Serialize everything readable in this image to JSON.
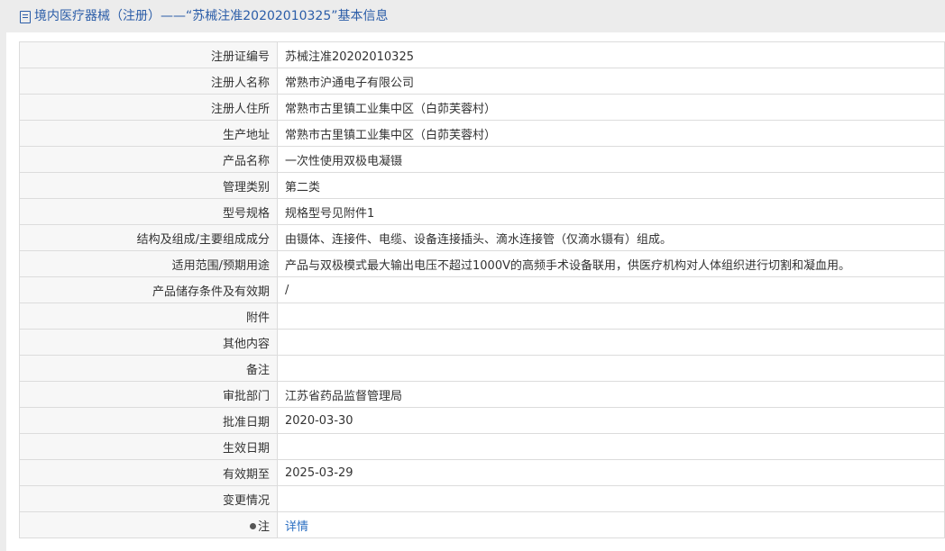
{
  "header": {
    "title": "境内医疗器械（注册）——“苏械注准20202010325”基本信息"
  },
  "rows": [
    {
      "label": "注册证编号",
      "value": "苏械注准20202010325"
    },
    {
      "label": "注册人名称",
      "value": "常熟市沪通电子有限公司"
    },
    {
      "label": "注册人住所",
      "value": "常熟市古里镇工业集中区（白茆芙蓉村）"
    },
    {
      "label": "生产地址",
      "value": "常熟市古里镇工业集中区（白茆芙蓉村）"
    },
    {
      "label": "产品名称",
      "value": "一次性使用双极电凝镊"
    },
    {
      "label": "管理类别",
      "value": "第二类"
    },
    {
      "label": "型号规格",
      "value": "规格型号见附件1"
    },
    {
      "label": "结构及组成/主要组成成分",
      "value": "由镊体、连接件、电缆、设备连接插头、滴水连接管（仅滴水镊有）组成。"
    },
    {
      "label": "适用范围/预期用途",
      "value": "产品与双极模式最大输出电压不超过1000V的高频手术设备联用，供医疗机构对人体组织进行切割和凝血用。"
    },
    {
      "label": "产品储存条件及有效期",
      "value": "/"
    },
    {
      "label": "附件",
      "value": ""
    },
    {
      "label": "其他内容",
      "value": ""
    },
    {
      "label": "备注",
      "value": ""
    },
    {
      "label": "审批部门",
      "value": "江苏省药品监督管理局"
    },
    {
      "label": "批准日期",
      "value": "2020-03-30"
    },
    {
      "label": "生效日期",
      "value": ""
    },
    {
      "label": "有效期至",
      "value": "2025-03-29"
    },
    {
      "label": "变更情况",
      "value": ""
    }
  ],
  "note_row": {
    "label": "注",
    "link": "详情"
  },
  "icons": {
    "header": "document-icon",
    "note": "pin-icon"
  }
}
